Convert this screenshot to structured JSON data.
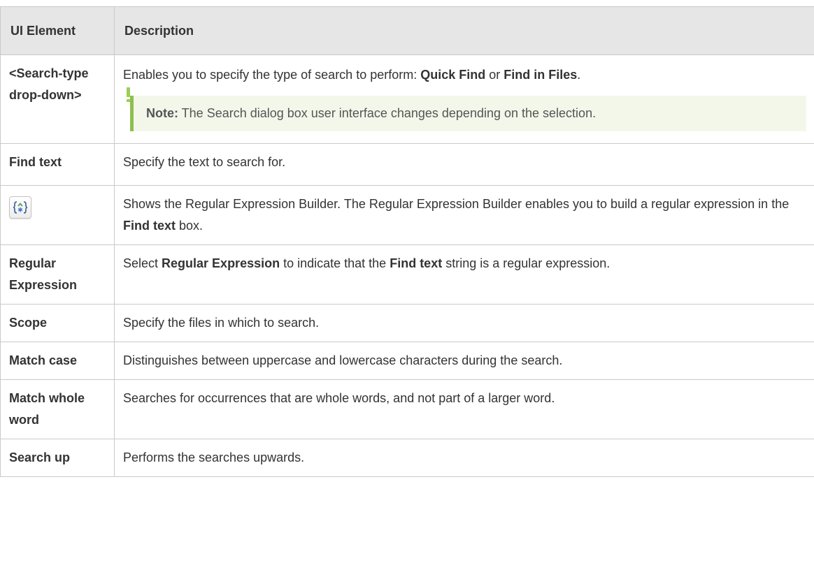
{
  "table": {
    "headers": {
      "element": "UI Element",
      "description": "Description"
    },
    "rows": [
      {
        "element": "<Search-type drop-down>",
        "description": {
          "t1": "Enables you to specify the type of search to perform: ",
          "b1": "Quick Find",
          "t2": " or ",
          "b2": "Find in Files",
          "t3": "."
        },
        "note": {
          "label": "Note:",
          "text": " The Search dialog box user interface changes depending on the selection."
        }
      },
      {
        "element": "Find text",
        "description": {
          "t1": "Specify the text to search for."
        }
      },
      {
        "element_icon": "regular-expression-builder-icon",
        "description": {
          "t1": "Shows the Regular Expression Builder. The Regular Expression Builder enables you to build a regular expression in the ",
          "b1": "Find text",
          "t2": " box."
        }
      },
      {
        "element": "Regular Expression",
        "description": {
          "t1": "Select ",
          "b1": "Regular Expression",
          "t2": " to indicate that the ",
          "b2": "Find text",
          "t3": " string is a regular expression."
        }
      },
      {
        "element": "Scope",
        "description": {
          "t1": "Specify the files in which to search."
        }
      },
      {
        "element": "Match case",
        "description": {
          "t1": "Distinguishes between uppercase and lowercase characters during the search."
        }
      },
      {
        "element": "Match whole word",
        "description": {
          "t1": "Searches for occurrences that are whole words, and not part of a larger word."
        }
      },
      {
        "element": "Search up",
        "description": {
          "t1": "Performs the searches upwards."
        }
      }
    ]
  },
  "colors": {
    "header_bg": "#e6e6e6",
    "border": "#c9c9c9",
    "note_bg": "#f2f7ea",
    "note_accent": "#8dbf4f",
    "text": "#333333"
  }
}
